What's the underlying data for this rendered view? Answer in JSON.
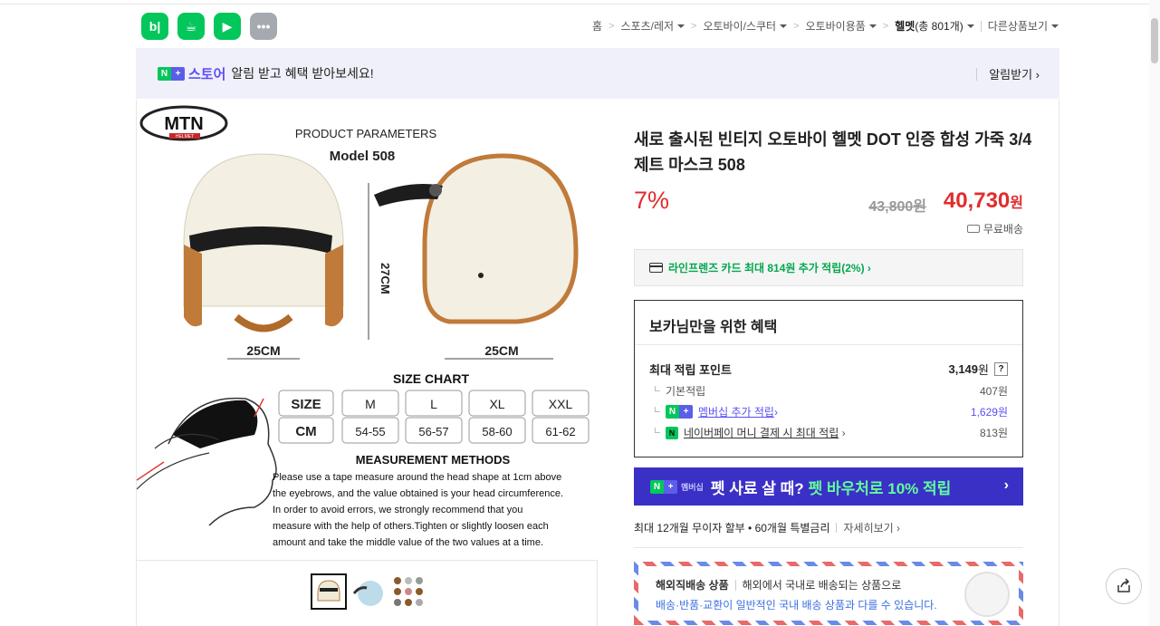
{
  "header": {
    "apps": [
      {
        "label": "b|",
        "icon": "blog-icon"
      },
      {
        "label": "☕",
        "icon": "cafe-icon"
      },
      {
        "label": "▶",
        "icon": "naver-store-icon"
      },
      {
        "label": "•••",
        "icon": "more-icon"
      }
    ],
    "breadcrumb": {
      "home": "홈",
      "c1": "스포츠/레저",
      "c2": "오토바이/스쿠터",
      "c3": "오토바이용품",
      "c4_name": "헬멧",
      "c4_count": "(총 801개)",
      "other": "다른상품보기"
    }
  },
  "banner": {
    "n": "N",
    "plus": "+",
    "store": "스토어",
    "message": "알림 받고 혜택 받아보세요!",
    "alarm": "알림받기 ›"
  },
  "product_image": {
    "brand": "MTN",
    "brand_sub": "HELMET",
    "params_title": "PRODUCT PARAMETERS",
    "model": "Model 508",
    "dim_height": "27CM",
    "dim_width_front": "25CM",
    "dim_width_side": "25CM",
    "size_chart_title": "SIZE CHART",
    "size_header": "SIZE",
    "cm_header": "CM",
    "sizes": [
      "M",
      "L",
      "XL",
      "XXL"
    ],
    "cms": [
      "54-55",
      "56-57",
      "58-60",
      "61-62"
    ],
    "measure_title": "MEASUREMENT METHODS",
    "measure_text": [
      "Please use a tape measure around the head shape at 1cm above",
      "the eyebrows, and the value obtained is your head circumference.",
      " In order to avoid errors, we strongly recommend that you",
      "measure with the help of others.Tighten or slightly loosen each",
      "amount and take the middle value of the two values at a time."
    ]
  },
  "product": {
    "title": "새로 출시된 빈티지 오토바이 헬멧 DOT 인증 합성 가죽 3/4 제트 마스크 508",
    "discount": "7%",
    "original_price": "43,800원",
    "price_number": "40,730",
    "price_unit": "원",
    "shipping": "무료배송",
    "card_benefit": "라인프렌즈 카드 최대 814원 추가 적립(2%) ›"
  },
  "benefit": {
    "header": "보카님만을 위한 혜택",
    "max_points_label": "최대 적립 포인트",
    "max_points_value": "3,149",
    "max_points_unit": "원",
    "qmark": "?",
    "basic_label": "기본적립",
    "basic_value": "407원",
    "membership_label": "멤버십 추가 적립",
    "membership_value": "1,629원",
    "npay_label": "네이버페이 머니 결제 시 최대 적립",
    "npay_value": "813원",
    "npay_badge": "N"
  },
  "pet_banner": {
    "membership": "멤버십",
    "text": "펫 사료 살 때?",
    "highlight": "펫 바우처로 10% 적립",
    "chevron": "›"
  },
  "installment": {
    "text": "최대 12개월 무이자 할부 • 60개월 특별금리",
    "more": "자세히보기 ›"
  },
  "overseas": {
    "title": "해외직배송 상품",
    "desc": "해외에서 국내로 배송되는 상품으로",
    "notice": "배송·반품·교환이 일반적인 국내 배송 상품과 다를 수 있습니다."
  },
  "colors": {
    "naver_green": "#03c75a",
    "price_red": "#e12c2c",
    "store_purple": "#5b4ff5",
    "pet_banner_bg": "#3b30c6",
    "pet_highlight": "#61ff9a"
  }
}
